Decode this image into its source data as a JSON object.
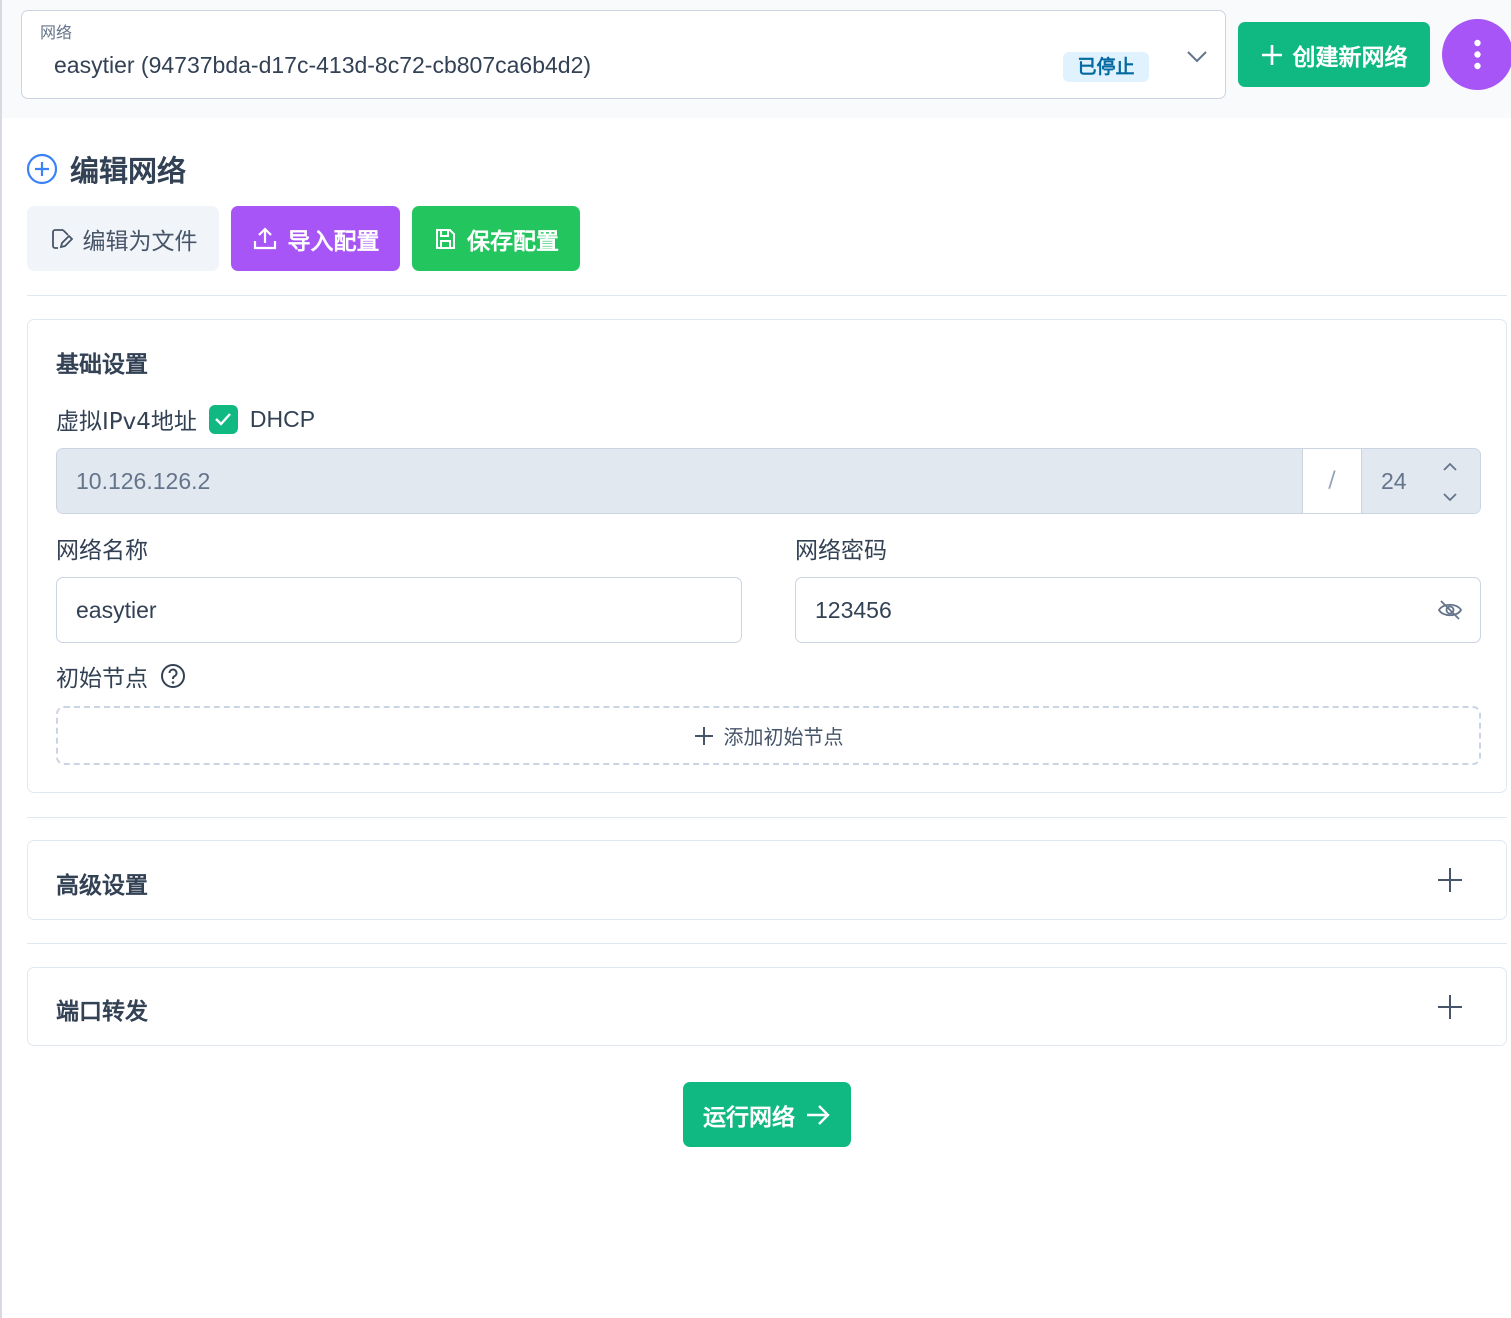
{
  "header": {
    "network_select": {
      "label": "网络",
      "value": "easytier (94737bda-d17c-413d-8c72-cb807ca6b4d2)",
      "status": "已停止"
    },
    "create_button": "创建新网络"
  },
  "editor": {
    "title": "编辑网络",
    "buttons": {
      "edit_as_file": "编辑为文件",
      "import_config": "导入配置",
      "save_config": "保存配置"
    }
  },
  "basic": {
    "title": "基础设置",
    "ipv4_label": "虚拟IPv4地址",
    "dhcp_label": "DHCP",
    "dhcp_checked": true,
    "ipv4_value": "10.126.126.2",
    "separator": "/",
    "mask_value": "24",
    "network_name_label": "网络名称",
    "network_name_value": "easytier",
    "network_secret_label": "网络密码",
    "network_secret_value": "123456",
    "initial_peers_label": "初始节点",
    "add_peer_button": "添加初始节点"
  },
  "advanced": {
    "title": "高级设置"
  },
  "port_forward": {
    "title": "端口转发"
  },
  "run_button": "运行网络",
  "colors": {
    "primary_green": "#10b981",
    "save_green": "#22c55e",
    "purple": "#a855f7",
    "status_bg": "#e0f2fe",
    "status_text": "#0369a1"
  }
}
